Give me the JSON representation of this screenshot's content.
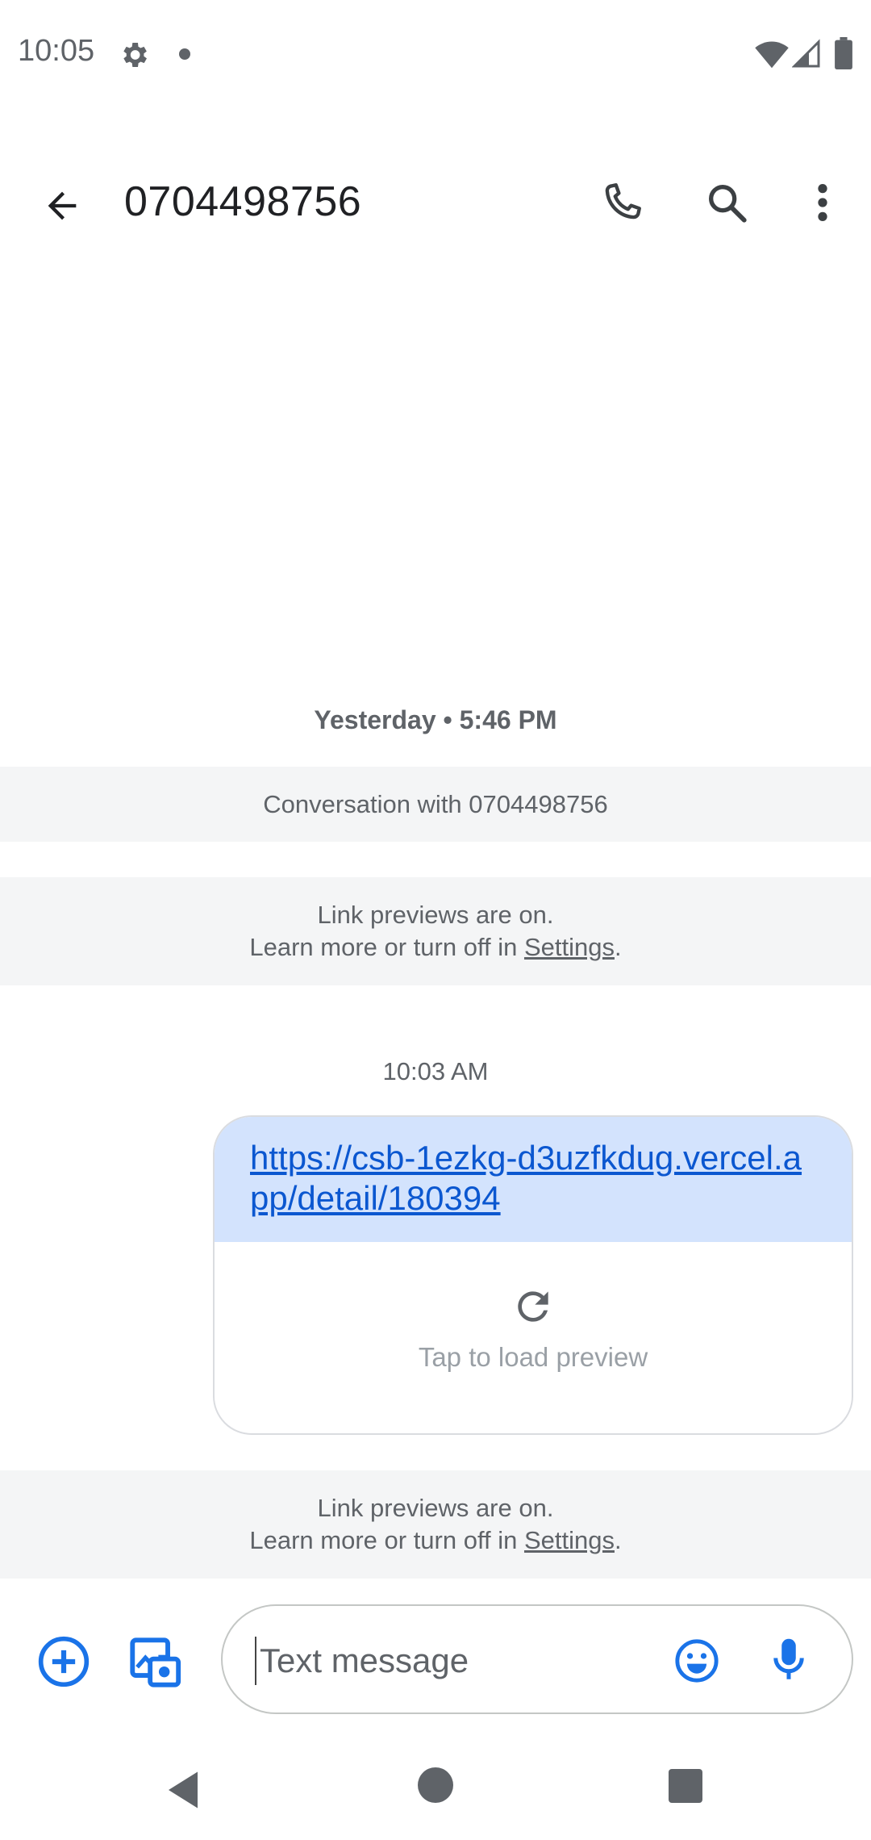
{
  "status_bar": {
    "time": "10:05",
    "icons": [
      "gear-icon",
      "notification-dot-icon",
      "wifi-icon",
      "signal-icon",
      "battery-icon"
    ]
  },
  "app_bar": {
    "title": "0704498756",
    "icons": [
      "back-arrow-icon",
      "phone-icon",
      "search-icon",
      "more-vert-icon"
    ]
  },
  "conversation": {
    "date_stamp": "Yesterday • 5:46 PM",
    "conversation_banner": "Conversation with 0704498756",
    "link_preview_banner": {
      "line1": "Link previews are on.",
      "line2_prefix": "Learn more or turn off in ",
      "settings_link": "Settings",
      "line2_suffix": "."
    },
    "message_time": "10:03 AM",
    "message": {
      "link": "https://csb-1ezkg-d3uzfkdug.vercel.app/detail/180394",
      "preview_label": "Tap to load preview"
    }
  },
  "compose": {
    "placeholder": "Text message",
    "value": "",
    "icons": [
      "add-circle-icon",
      "gallery-camera-icon",
      "emoji-icon",
      "mic-icon"
    ]
  },
  "nav_bar": {
    "icons": [
      "nav-back-icon",
      "nav-home-icon",
      "nav-recents-icon"
    ]
  },
  "colors": {
    "accent": "#1a73e8",
    "bubble_bg": "#d3e3fd",
    "link": "#0b57d0",
    "banner_bg": "#f4f5f6",
    "secondary_text": "#5f6368"
  }
}
